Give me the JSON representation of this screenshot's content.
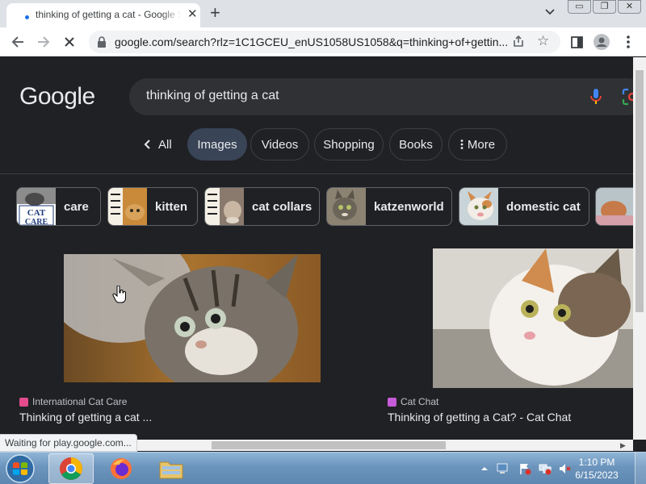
{
  "browser": {
    "tab": {
      "title": "thinking of getting a cat - Google Search",
      "close_glyph": "✕"
    },
    "new_tab_glyph": "+",
    "tab_search_icon": "chevron-down-icon",
    "window_controls": {
      "minimize": "▭",
      "restore": "❐",
      "close": "✕"
    },
    "url": "google.com/search?rlz=1C1GCEU_enUS1058US1058&q=thinking+of+gettin...",
    "status_text": "Waiting for play.google.com..."
  },
  "google": {
    "logo": "Google",
    "query": "thinking of getting a cat",
    "nav": {
      "all_label": "All",
      "tabs": [
        {
          "label": "Images"
        },
        {
          "label": "Videos"
        },
        {
          "label": "Shopping"
        },
        {
          "label": "Books"
        },
        {
          "label": "More"
        }
      ]
    },
    "related": [
      {
        "label": "care",
        "thumb_text": "CAT CARE"
      },
      {
        "label": "kitten"
      },
      {
        "label": "cat collars"
      },
      {
        "label": "katzenworld"
      },
      {
        "label": "domestic cat"
      }
    ],
    "results": [
      {
        "source": "International Cat Care",
        "title": "Thinking of getting a cat ..."
      },
      {
        "source": "Cat Chat",
        "title": "Thinking of getting a Cat? - Cat Chat"
      }
    ]
  },
  "taskbar": {
    "time": "1:10 PM",
    "date": "6/15/2023"
  },
  "colors": {
    "page_bg": "#202124",
    "active_chip": "#394457",
    "link_text": "#e8eaed"
  }
}
